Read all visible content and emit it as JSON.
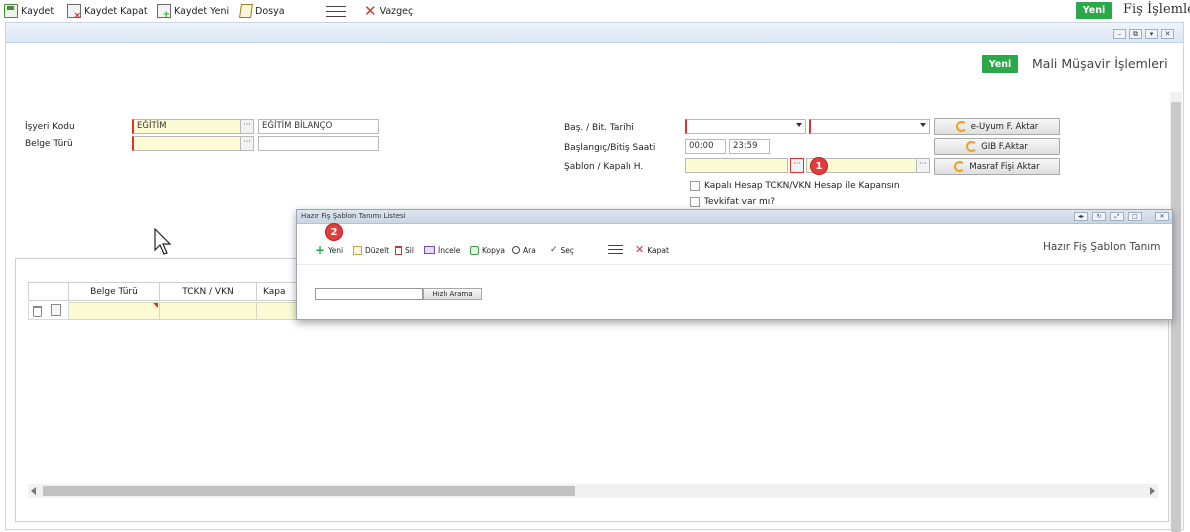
{
  "toolbar": {
    "kaydet": "Kaydet",
    "kaydet_kapat": "Kaydet Kapat",
    "kaydet_yeni": "Kaydet Yeni",
    "dosya": "Dosya",
    "vazgec": "Vazgeç",
    "yeni": "Yeni",
    "title": "Fiş İşlemle"
  },
  "form": {
    "yeni": "Yeni",
    "title": "Mali Müşavir İşlemleri",
    "isyeri_kodu_label": "İşyeri Kodu",
    "isyeri_kodu_value": "EĞİTİM",
    "isyeri_adi_value": "EĞİTİM BİLANÇO",
    "belge_turu_label": "Belge Türü",
    "bas_bit_tarihi_label": "Baş. / Bit. Tarihi",
    "bas_bit_saati_label": "Başlangıç/Bitiş Saati",
    "bas_saati": "00:00",
    "bit_saati": "23:59",
    "sablon_label": "Şablon / Kapalı H.",
    "euyum_btn": "e-Uyum F. Aktar",
    "gib_btn": "GIB F.Aktar",
    "masraf_btn": "Masraf Fişi Aktar",
    "kapali_hesap_chk": "Kapalı Hesap TCKN/VKN Hesap ile Kapansın",
    "tevkifat_chk": "Tevkifat var mı?",
    "dots": "···"
  },
  "grid": {
    "columns": [
      "Belge Türü",
      "TCKN / VKN",
      "Kapa"
    ]
  },
  "modal": {
    "title": "Hazır Fiş Şablon Tanımı Listesi",
    "yeni": "Yeni",
    "duzelt": "Düzelt",
    "sil": "Sil",
    "incele": "İncele",
    "kopya": "Kopya",
    "ara": "Ara",
    "sec": "Seç",
    "kapat": "Kapat",
    "heading": "Hazır Fiş Şablon Tanım",
    "search_value": "",
    "search_btn": "Hızlı Arama"
  },
  "annotations": {
    "step1": "1",
    "step2": "2"
  },
  "colors": {
    "green": "#2aa84a",
    "required": "#e03030",
    "field_yellow": "#fdfbd4",
    "callout_red": "#e23c3c"
  }
}
